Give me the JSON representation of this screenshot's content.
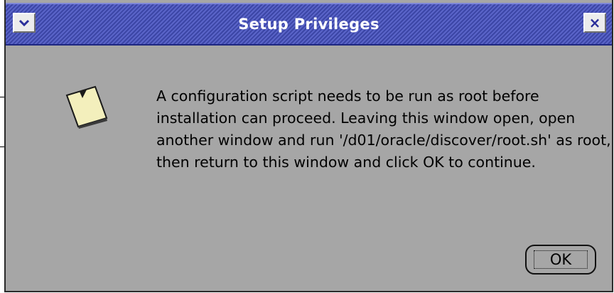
{
  "dialog": {
    "title": "Setup Privileges",
    "menu_icon": "chevron-down-icon",
    "close_icon": "close-icon",
    "close_glyph": "×",
    "message_icon": "note-icon",
    "message": "A configuration script needs to be run as root before installation can proceed. Leaving this window open, open another window and run '/d01/oracle/discover/root.sh' as root, then return to this window and click OK to continue.",
    "ok_label": "OK"
  },
  "colors": {
    "window_bg": "#a6a6a6",
    "titlebar": "#3c46a6",
    "title_text": "#ffffff",
    "note_fill": "#f3efbc"
  }
}
